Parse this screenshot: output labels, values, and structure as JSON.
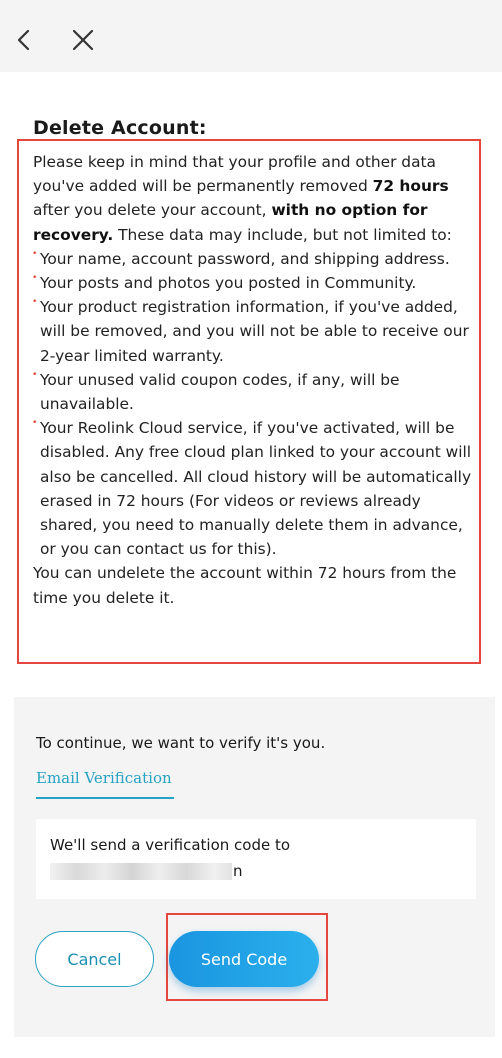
{
  "header": {
    "back_icon": "chevron-left-icon",
    "close_icon": "close-icon"
  },
  "notice": {
    "title": "Delete Account:",
    "intro_part1": "Please keep in mind that your profile and other data you've added will be permanently removed ",
    "intro_bold1": "72 hours",
    "intro_part2": " after you delete your account, ",
    "intro_bold2": "with no option for recovery.",
    "intro_part3": " These data may include, but not limited to:",
    "items": [
      "Your name, account password, and shipping address.",
      "Your posts and photos you posted in Community.",
      "Your product registration information, if you've added, will be removed, and you will not be able to receive our 2-year limited warranty.",
      "Your unused valid coupon codes, if any, will be unavailable.",
      "Your Reolink Cloud service, if you've activated, will be disabled. Any free cloud plan linked to your account will also be cancelled. All cloud history will be automatically erased in 72 hours (For videos or reviews already shared, you need to manually delete them in advance, or you can contact us for this)."
    ],
    "outro": "You can undelete the account within 72 hours from the time you delete it.",
    "highlight_color": "#e5463e"
  },
  "verify": {
    "heading": "To continue, we want to verify it's you.",
    "tab_label": "Email Verification",
    "code_text": "We'll send a verification code to",
    "email_visible_tail": "n",
    "accent_color": "#25a2c4"
  },
  "actions": {
    "cancel_label": "Cancel",
    "send_label": "Send Code"
  }
}
